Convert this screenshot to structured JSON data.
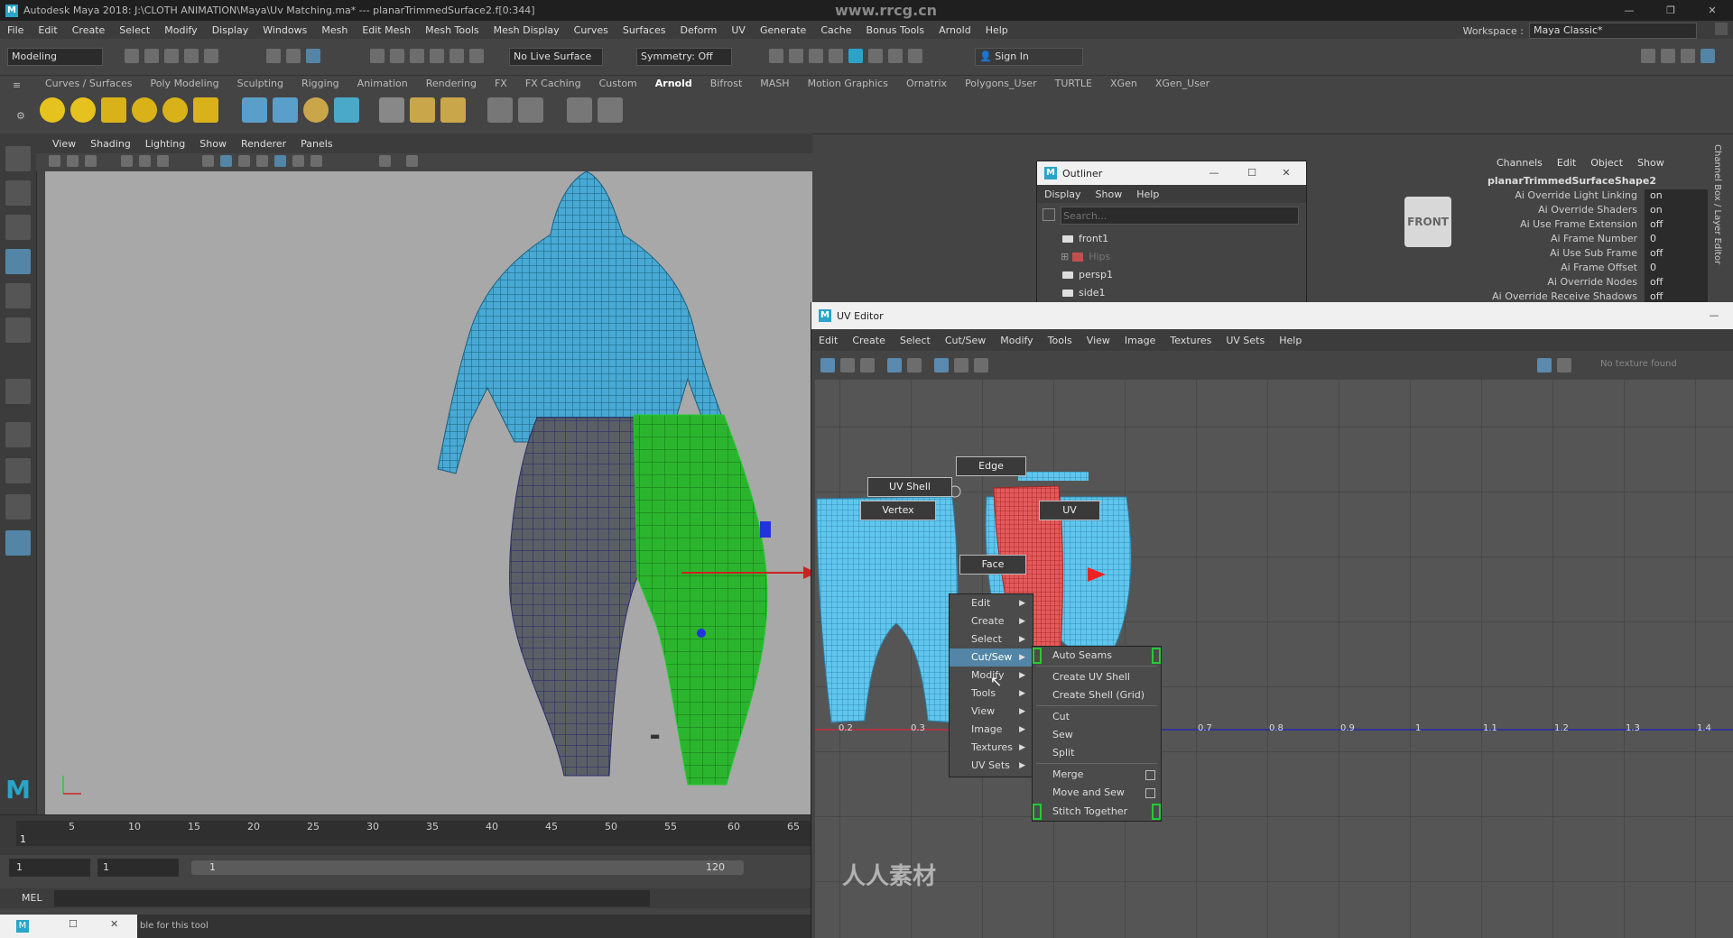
{
  "title_bar": {
    "title": "Autodesk Maya 2018: J:\\CLOTH ANIMATION\\Maya\\Uv Matching.ma*  ---  planarTrimmedSurface2.f[0:344]",
    "watermark": "www.rrcg.cn"
  },
  "main_menu": [
    "File",
    "Edit",
    "Create",
    "Select",
    "Modify",
    "Display",
    "Windows",
    "Mesh",
    "Edit Mesh",
    "Mesh Tools",
    "Mesh Display",
    "Curves",
    "Surfaces",
    "Deform",
    "UV",
    "Generate",
    "Cache",
    "Bonus Tools",
    "Arnold",
    "Help"
  ],
  "workspace": {
    "label": "Workspace :",
    "value": "Maya Classic*"
  },
  "status_line": {
    "mode": "Modeling",
    "live_surface": "No Live Surface",
    "symmetry": "Symmetry: Off",
    "sign_in": "Sign In"
  },
  "shelf_tabs": [
    "Curves / Surfaces",
    "Poly Modeling",
    "Sculpting",
    "Rigging",
    "Animation",
    "Rendering",
    "FX",
    "FX Caching",
    "Custom",
    "Arnold",
    "Bifrost",
    "MASH",
    "Motion Graphics",
    "Ornatrix",
    "Polygons_User",
    "TURTLE",
    "XGen",
    "XGen_User"
  ],
  "shelf_active": "Arnold",
  "viewport_menu": [
    "View",
    "Shading",
    "Lighting",
    "Show",
    "Renderer",
    "Panels"
  ],
  "timeline": {
    "ticks": [
      "1",
      "5",
      "10",
      "15",
      "20",
      "25",
      "30",
      "35",
      "40",
      "45",
      "50",
      "55",
      "60",
      "65"
    ],
    "range_start": "1",
    "range_start2": "1",
    "slider_start": "1",
    "slider_end": "120"
  },
  "mel_label": "MEL",
  "help_line": "ble for this tool",
  "outliner": {
    "title": "Outliner",
    "menu": [
      "Display",
      "Show",
      "Help"
    ],
    "search_placeholder": "Search...",
    "items": [
      "front1",
      "Hips",
      "persp1",
      "side1"
    ]
  },
  "view_cube": {
    "label": "FRONT"
  },
  "channel_box": {
    "menu": [
      "Channels",
      "Edit",
      "Object",
      "Show"
    ],
    "object": "planarTrimmedSurfaceShape2",
    "side_tab": "Channel Box / Layer Editor",
    "attributes": [
      {
        "name": "Ai Override Light Linking",
        "value": "on"
      },
      {
        "name": "Ai Override Shaders",
        "value": "on"
      },
      {
        "name": "Ai Use Frame Extension",
        "value": "off"
      },
      {
        "name": "Ai Frame Number",
        "value": "0"
      },
      {
        "name": "Ai Use Sub Frame",
        "value": "off"
      },
      {
        "name": "Ai Frame Offset",
        "value": "0"
      },
      {
        "name": "Ai Override Nodes",
        "value": "off"
      },
      {
        "name": "Ai Override Receive Shadows",
        "value": "off"
      }
    ]
  },
  "uv_editor": {
    "title": "UV Editor",
    "menu": [
      "Edit",
      "Create",
      "Select",
      "Cut/Sew",
      "Modify",
      "Tools",
      "View",
      "Image",
      "Textures",
      "UV Sets",
      "Help"
    ],
    "texture_status": "No texture found",
    "axis_labels": [
      "0.2",
      "0.3",
      "0.7",
      "0.8",
      "0.9",
      "1",
      "1.1",
      "1.2",
      "1.3",
      "1.4"
    ],
    "marking_menu": {
      "north": "Edge",
      "northwest": "UV Shell",
      "west": "Vertex",
      "east": "UV",
      "south": "Face"
    },
    "context_menu": [
      {
        "label": "Edit",
        "submenu": true
      },
      {
        "label": "Create",
        "submenu": true
      },
      {
        "label": "Select",
        "submenu": true
      },
      {
        "label": "Cut/Sew",
        "submenu": true,
        "highlighted": true
      },
      {
        "label": "Modify",
        "submenu": true
      },
      {
        "label": "Tools",
        "submenu": true
      },
      {
        "label": "View",
        "submenu": true
      },
      {
        "label": "Image",
        "submenu": true
      },
      {
        "label": "Textures",
        "submenu": true
      },
      {
        "label": "UV Sets",
        "submenu": true
      }
    ],
    "cutsew_submenu": [
      {
        "label": "Auto Seams",
        "option": true
      },
      {
        "label": "Create UV Shell",
        "option": false
      },
      {
        "label": "Create Shell (Grid)",
        "option": false
      },
      {
        "label": "Cut",
        "option": false
      },
      {
        "label": "Sew",
        "option": false
      },
      {
        "label": "Split",
        "option": false
      },
      {
        "label": "Merge",
        "option": true
      },
      {
        "label": "Move and Sew",
        "option": true
      },
      {
        "label": "Stitch Together",
        "option": true
      }
    ]
  },
  "watermark_bottom": "人人素材",
  "colors": {
    "maya_blue": "#2aa4c7",
    "highlight": "#5285a6",
    "uv_mesh": "#5cc8ee",
    "green_selection": "#22cc33"
  }
}
